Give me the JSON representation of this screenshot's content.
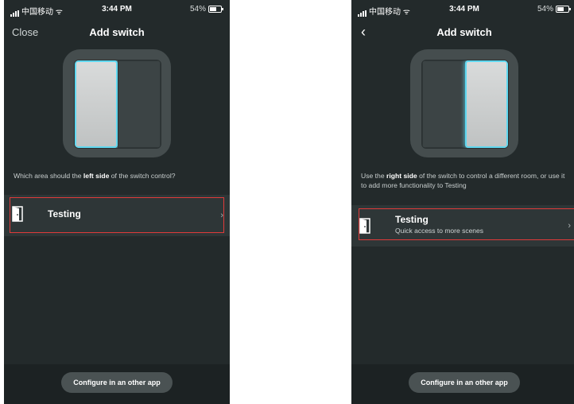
{
  "status_bar": {
    "carrier": "中国移动",
    "time": "3:44 PM",
    "battery": "54%"
  },
  "left_screen": {
    "close_label": "Close",
    "title": "Add switch",
    "question_before": "Which area should the ",
    "question_bold": "left side",
    "question_after": " of the switch control?",
    "room": {
      "name": "Testing"
    },
    "configure_label": "Configure in an other app"
  },
  "right_screen": {
    "title": "Add switch",
    "back_icon": "chevron-left-icon",
    "info_before": "Use the ",
    "info_bold": "right side",
    "info_after": " of the switch to control a different room, or use it to add more functionality to Testing",
    "room": {
      "name": "Testing",
      "subtitle": "Quick access to more scenes"
    },
    "configure_label": "Configure in an other app"
  },
  "colors": {
    "background": "#232a2b",
    "accent_glow": "#5fd8f0",
    "highlight": "#e03a3a"
  }
}
